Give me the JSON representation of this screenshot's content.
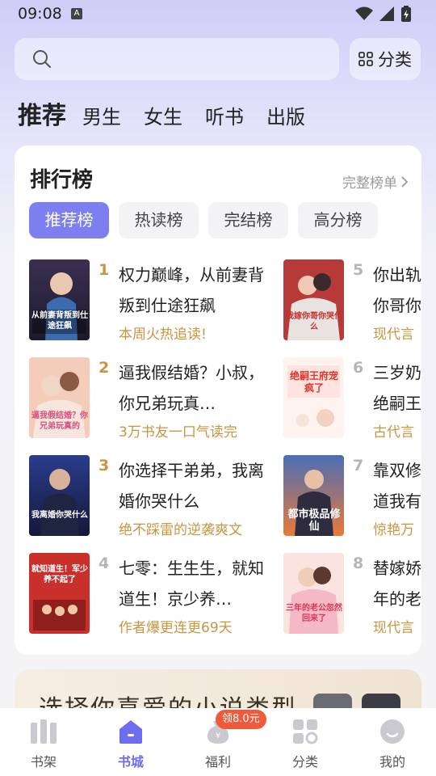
{
  "status_bar": {
    "time": "09:08",
    "a_label": "A"
  },
  "search": {
    "placeholder": ""
  },
  "category_button": {
    "label": "分类",
    "icon": "grid-icon"
  },
  "channels": [
    {
      "label": "推荐",
      "active": true
    },
    {
      "label": "男生"
    },
    {
      "label": "女生"
    },
    {
      "label": "听书"
    },
    {
      "label": "出版"
    }
  ],
  "ranking": {
    "title": "排行榜",
    "more": "完整榜单",
    "tabs": [
      {
        "label": "推荐榜",
        "active": true
      },
      {
        "label": "热读榜"
      },
      {
        "label": "完结榜"
      },
      {
        "label": "高分榜"
      }
    ],
    "books": [
      {
        "rank": "1",
        "title": "权力巅峰，从前妻背叛到仕途狂飙",
        "tag": "本周火热追读!",
        "cover_text": "从前妻背叛到仕途狂飙"
      },
      {
        "rank": "2",
        "title": "逼我假结婚？小叔，你兄弟玩真…",
        "tag": "3万书友一口气读完",
        "cover_text": "逼我假结婚？你兄弟玩真的"
      },
      {
        "rank": "3",
        "title": "你选择干弟弟，我离婚你哭什么",
        "tag": "绝不踩雷的逆袭爽文",
        "cover_text": "我离婚你哭什么"
      },
      {
        "rank": "4",
        "title": "七零：生生生，就知道生！京少养…",
        "tag": "作者爆更连更69天",
        "cover_text": "就知道生！军少养不起了"
      },
      {
        "rank": "5",
        "title": "你出轨你哥你",
        "tag": "现代言",
        "cover_text": "我嫁你哥你哭什么"
      },
      {
        "rank": "6",
        "title": "三岁奶绝嗣王",
        "tag": "古代言",
        "cover_text": "绝嗣王府宠疯了"
      },
      {
        "rank": "7",
        "title": "靠双修道我有",
        "tag": "惊艳万",
        "cover_text": "都市极品修仙"
      },
      {
        "rank": "8",
        "title": "替嫁娇年的老",
        "tag": "现代言",
        "cover_text": "三年的老公忽然回来了"
      }
    ]
  },
  "promo": {
    "text": "选择你喜爱的小说类型"
  },
  "bottom_nav": [
    {
      "label": "书架",
      "icon": "bookshelf-icon"
    },
    {
      "label": "书城",
      "icon": "home-icon",
      "active": true
    },
    {
      "label": "福利",
      "icon": "coin-bag-icon"
    },
    {
      "label": "分类",
      "icon": "category-icon"
    },
    {
      "label": "我的",
      "icon": "profile-icon"
    }
  ],
  "welfare_badge": "领8.0元",
  "colors": {
    "accent": "#7d7ef0",
    "rank_gold": "#c9953f",
    "rank_gray": "#b5b5b5",
    "tag": "#c9953f",
    "badge": "#f05a3b"
  }
}
